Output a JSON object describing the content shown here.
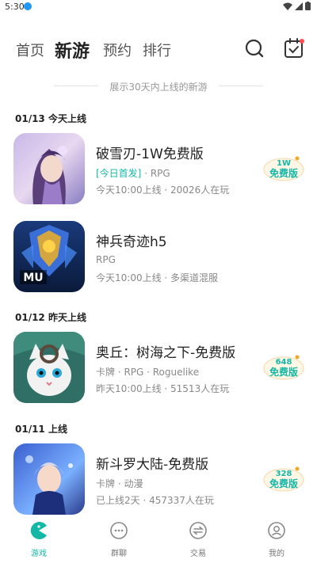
{
  "status_bar": {
    "time": "5:30",
    "notification_badge": "0"
  },
  "top_nav": {
    "tabs": [
      {
        "label": "首页",
        "active": false
      },
      {
        "label": "新游",
        "active": true
      },
      {
        "label": "预约",
        "active": false
      },
      {
        "label": "排行",
        "active": false
      }
    ],
    "icons": [
      "search-icon",
      "calendar-check-icon"
    ]
  },
  "subtitle": "展示30天内上线的新游",
  "sections": [
    {
      "header": "01/13 今天上线"
    },
    {
      "header": "01/12 昨天上线"
    },
    {
      "header": "01/11 上线"
    }
  ],
  "games": [
    {
      "title": "破雪刃-1W免费版",
      "tag_highlight": "[今日首发]",
      "tags": " · RPG",
      "meta": "今天10:00上线 · 20026人在玩",
      "badge_top": "1W",
      "badge_label": "免费版"
    },
    {
      "title": "神兵奇迹h5",
      "tag_highlight": "",
      "tags": "RPG",
      "meta": "今天10:00上线 · 多渠道混服",
      "badge_top": "",
      "badge_label": ""
    },
    {
      "title": "奥丘：树海之下-免费版",
      "tag_highlight": "",
      "tags": "卡牌 · RPG · Roguelike",
      "meta": "昨天10:00上线 · 51513人在玩",
      "badge_top": "648",
      "badge_label": "免费版"
    },
    {
      "title": "新斗罗大陆-免费版",
      "tag_highlight": "",
      "tags": "卡牌 · 动漫",
      "meta": "已上线2天 · 457337人在玩",
      "badge_top": "328",
      "badge_label": "免费版"
    }
  ],
  "game2_logo_text": "MU",
  "bottom_tabs": [
    {
      "label": "游戏",
      "icon": "pacman-icon",
      "active": true
    },
    {
      "label": "群聊",
      "icon": "chat-bubble-icon",
      "active": false
    },
    {
      "label": "交易",
      "icon": "exchange-icon",
      "active": false
    },
    {
      "label": "我的",
      "icon": "profile-icon",
      "active": false
    }
  ],
  "colors": {
    "accent": "#14b8a6",
    "badge_orange": "#f5a623"
  }
}
